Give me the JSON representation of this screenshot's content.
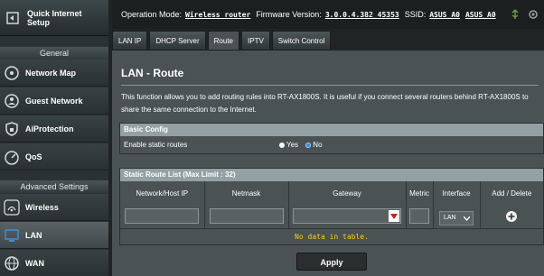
{
  "sidebar": {
    "qis_label_line1": "Quick Internet",
    "qis_label_line2": "Setup",
    "general_heading": "General",
    "general_items": [
      {
        "label": "Network Map",
        "icon": "network-map-icon"
      },
      {
        "label": "Guest Network",
        "icon": "guest-network-icon"
      },
      {
        "label": "AiProtection",
        "icon": "shield-lock-icon"
      },
      {
        "label": "QoS",
        "icon": "speedometer-icon"
      }
    ],
    "advanced_heading": "Advanced Settings",
    "advanced_items": [
      {
        "label": "Wireless",
        "icon": "wireless-icon"
      },
      {
        "label": "LAN",
        "icon": "lan-icon"
      },
      {
        "label": "WAN",
        "icon": "globe-icon"
      }
    ]
  },
  "topbar": {
    "op_mode_label": "Operation Mode:",
    "op_mode_value": "Wireless router",
    "fw_label": "Firmware Version:",
    "fw_value": "3.0.0.4.382_45353",
    "ssid_label": "SSID:",
    "ssid_1": "ASUS_A0",
    "ssid_2": "ASUS_A0"
  },
  "tabs": [
    "LAN IP",
    "DHCP Server",
    "Route",
    "IPTV",
    "Switch Control"
  ],
  "active_tab": "Route",
  "page": {
    "title": "LAN - Route",
    "description": "This function allows you to add routing rules into RT-AX1800S. It is useful if you connect several routers behind RT-AX1800S to share the same connection to the Internet."
  },
  "basic_config": {
    "heading": "Basic Config",
    "row_label": "Enable static routes",
    "opt_yes": "Yes",
    "opt_no": "No",
    "selected": "No"
  },
  "static_routes": {
    "heading": "Static Route List (Max Limit : 32)",
    "columns": [
      "Network/Host IP",
      "Netmask",
      "Gateway",
      "Metric",
      "Interface",
      "Add / Delete"
    ],
    "interface_value": "LAN",
    "empty_text": "No data in table."
  },
  "apply_label": "Apply",
  "colors": {
    "accent_blue": "#3a8fd8",
    "empty_text": "#ffcc00"
  }
}
